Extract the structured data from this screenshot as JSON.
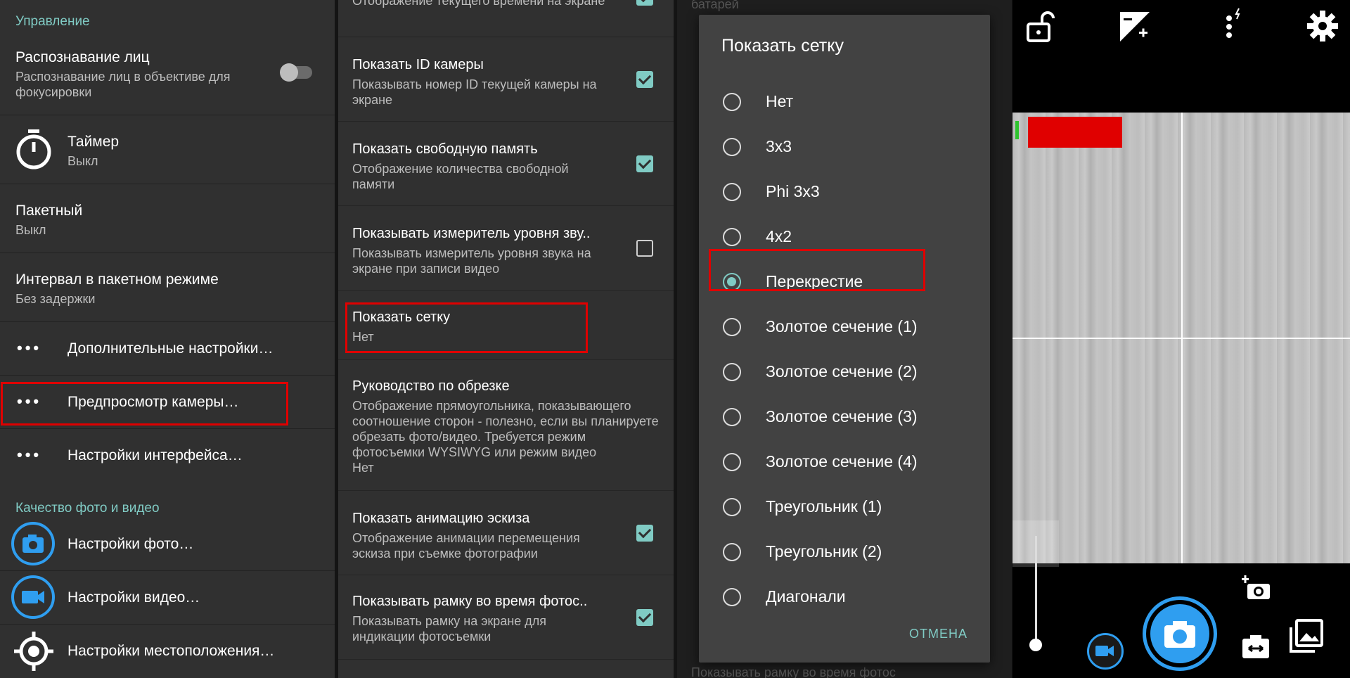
{
  "panel1": {
    "section_control": "Управление",
    "face": {
      "title": "Распознавание лиц",
      "sub": "Распознавание лиц в объективе для фокусировки",
      "toggle_on": false
    },
    "timer": {
      "title": "Таймер",
      "sub": "Выкл"
    },
    "burst": {
      "title": "Пакетный",
      "sub": "Выкл"
    },
    "burst_interval": {
      "title": "Интервал в пакетном режиме",
      "sub": "Без задержки"
    },
    "more_settings": "Дополнительные настройки…",
    "camera_preview": "Предпросмотр камеры…",
    "ui_settings": "Настройки интерфейса…",
    "section_quality": "Качество фото и видео",
    "photo_settings": "Настройки фото…",
    "video_settings": "Настройки видео…",
    "location_settings": "Настройки местоположения…"
  },
  "panel2": {
    "top_sub": "Отображение текущего времени на экране",
    "camera_id": {
      "title": "Показать ID камеры",
      "sub": "Показывать номер ID текущей камеры на экране",
      "checked": true
    },
    "free_mem": {
      "title": "Показать свободную память",
      "sub": "Отображение количества свободной памяти",
      "checked": true
    },
    "sound_meter": {
      "title": "Показывать измеритель уровня зву..",
      "sub": "Показывать измеритель уровня звука на экране при записи видео",
      "checked": false
    },
    "grid": {
      "title": "Показать сетку",
      "sub": "Нет"
    },
    "crop_guide": {
      "title": "Руководство по обрезке",
      "sub": "Отображение прямоугольника, показывающего соотношение сторон - полезно, если вы планируете обрезать фото/видео. Требуется режим фотосъемки WYSIWYG или режим видео",
      "value": "Нет"
    },
    "thumb_anim": {
      "title": "Показать анимацию эскиза",
      "sub": "Отображение анимации перемещения эскиза при съемке фотографии",
      "checked": true
    },
    "frame": {
      "title": "Показывать рамку во время фотос..",
      "sub": "Показывать рамку на экране для индикации фотосъемки",
      "checked": true
    }
  },
  "panel3": {
    "bg_top": "батарей",
    "bg_bottom": "Показывать рамку во время фотос",
    "dialog_title": "Показать сетку",
    "options": [
      "Нет",
      "3x3",
      "Phi 3x3",
      "4x2",
      "Перекрестие",
      "Золотое сечение (1)",
      "Золотое сечение (2)",
      "Золотое сечение (3)",
      "Золотое сечение (4)",
      "Треугольник (1)",
      "Треугольник (2)",
      "Диагонали"
    ],
    "selected": "Перекрестие",
    "cancel": "ОТМЕНА"
  },
  "panel4": {
    "icons": [
      "lock-open-icon",
      "exposure-icon",
      "flash-off-icon",
      "gear-icon",
      "add-camera-icon",
      "switch-camera-icon",
      "gallery-icon",
      "video-icon",
      "camera-icon"
    ],
    "zoom_level": 0
  },
  "colors": {
    "accent": "#80cbc4",
    "highlight": "#e00000",
    "camera_blue": "#2f9ef0"
  }
}
